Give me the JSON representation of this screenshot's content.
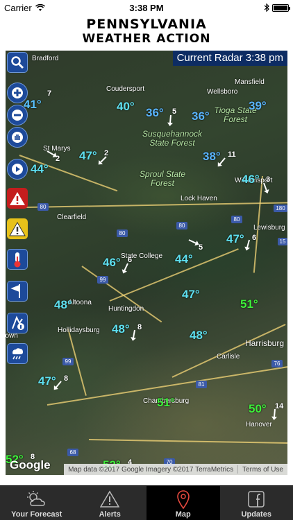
{
  "status": {
    "carrier": "Carrier",
    "time": "3:38 PM",
    "battery_fill": 1.0
  },
  "header": {
    "line1": "PENNSYLVANIA",
    "line2": "WEATHER ACTION"
  },
  "map": {
    "radar_label": "Current Radar 3:38 pm",
    "google": "Google",
    "attribution": [
      "Map data ©2017 Google Imagery ©2017 TerraMetrics",
      "Terms of Use"
    ],
    "places": [
      "Bradford",
      "Coudersport",
      "Wellsboro",
      "Mansfield",
      "St Marys",
      "Tioga State Forest",
      "Williamsport",
      "Lock Haven",
      "Clearfield",
      "Lewisburg",
      "State College",
      "Huntingdon",
      "Altoona",
      "Hollidaysburg",
      "Johnstown",
      "Harrisburg",
      "Carlisle",
      "Chambersburg",
      "Hanover"
    ],
    "regions": [
      "Susquehannock State Forest",
      "Sproul State Forest",
      "Tioga State Forest"
    ],
    "highways": [
      "80",
      "80",
      "80",
      "80",
      "180",
      "99",
      "99",
      "81",
      "76",
      "68",
      "70",
      "15"
    ],
    "temps": [
      {
        "v": "41°",
        "c": "#59c2ff"
      },
      {
        "v": "40°",
        "c": "#5ee0f0"
      },
      {
        "v": "36°",
        "c": "#59b4ff"
      },
      {
        "v": "36°",
        "c": "#59b4ff"
      },
      {
        "v": "39°",
        "c": "#59b4ff"
      },
      {
        "v": "47°",
        "c": "#5ee0f0"
      },
      {
        "v": "44°",
        "c": "#5ee0f0"
      },
      {
        "v": "38°",
        "c": "#59b4ff"
      },
      {
        "v": "46°",
        "c": "#5ee0f0"
      },
      {
        "v": "47°",
        "c": "#5ee0f0"
      },
      {
        "v": "46°",
        "c": "#5ee0f0"
      },
      {
        "v": "44°",
        "c": "#5ee0f0"
      },
      {
        "v": "47°",
        "c": "#5ee0f0"
      },
      {
        "v": "48°",
        "c": "#5ee0f0"
      },
      {
        "v": "51°",
        "c": "#3ef03a"
      },
      {
        "v": "48°",
        "c": "#5ee0f0"
      },
      {
        "v": "48°",
        "c": "#5ee0f0"
      },
      {
        "v": "47°",
        "c": "#5ee0f0"
      },
      {
        "v": "51°",
        "c": "#3ef03a"
      },
      {
        "v": "50°",
        "c": "#3ef03a"
      },
      {
        "v": "52°",
        "c": "#3ef03a"
      },
      {
        "v": "52°",
        "c": "#3ef03a"
      }
    ],
    "winds": [
      "7",
      "5",
      "2",
      "2",
      "11",
      "3",
      "5",
      "6",
      "6",
      "8",
      "8",
      "4",
      "14",
      "8"
    ]
  },
  "tools": [
    "search-icon",
    "zoom-in-icon",
    "zoom-out-icon",
    "pan-hand-icon",
    "play-icon",
    "warning-red-icon",
    "warning-yellow-icon",
    "thermometer-icon",
    "wind-icon",
    "storm-info-icon",
    "rain-icon"
  ],
  "tabs": [
    {
      "label": "Your Forecast",
      "icon": "sun-cloud-icon",
      "active": false
    },
    {
      "label": "Alerts",
      "icon": "warning-icon",
      "active": false
    },
    {
      "label": "Map",
      "icon": "map-pin-icon",
      "active": true
    },
    {
      "label": "Updates",
      "icon": "facebook-icon",
      "active": false
    }
  ]
}
